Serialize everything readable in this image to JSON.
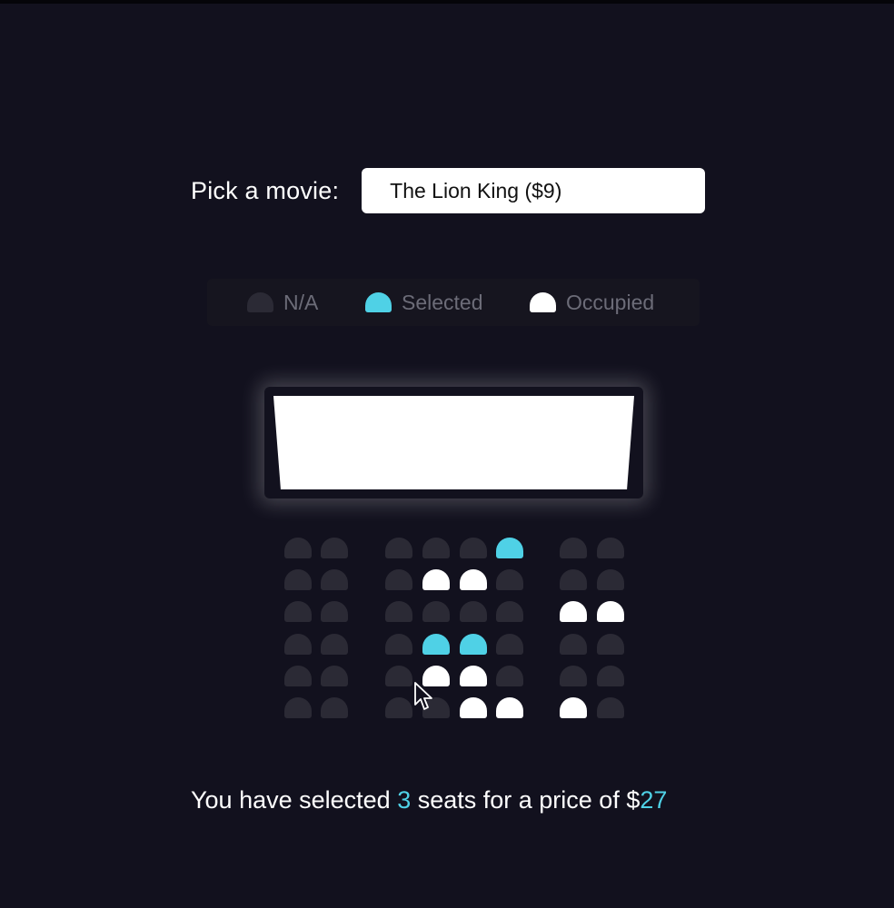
{
  "colors": {
    "background": "#12111e",
    "seat_na": "#2b2a35",
    "seat_selected": "#4fd1e6",
    "seat_occupied": "#ffffff",
    "accent": "#4fd1e6"
  },
  "movie_picker": {
    "label": "Pick a movie:",
    "selected_value": "The Lion King ($9)"
  },
  "legend": [
    {
      "status": "na",
      "label": "N/A"
    },
    {
      "status": "selected",
      "label": "Selected"
    },
    {
      "status": "occupied",
      "label": "Occupied"
    }
  ],
  "seat_rows": [
    [
      "na",
      "na",
      "na",
      "na",
      "na",
      "selected",
      "na",
      "na"
    ],
    [
      "na",
      "na",
      "na",
      "occupied",
      "occupied",
      "na",
      "na",
      "na"
    ],
    [
      "na",
      "na",
      "na",
      "na",
      "na",
      "na",
      "occupied",
      "occupied"
    ],
    [
      "na",
      "na",
      "na",
      "selected",
      "selected",
      "na",
      "na",
      "na"
    ],
    [
      "na",
      "na",
      "na",
      "occupied",
      "occupied",
      "na",
      "na",
      "na"
    ],
    [
      "na",
      "na",
      "na",
      "na",
      "occupied",
      "occupied",
      "occupied",
      "na"
    ]
  ],
  "summary": {
    "prefix": "You have selected ",
    "count": "3",
    "middle": " seats for a price of $",
    "total": "27"
  },
  "cursor_icon": "arrow-pointer-icon"
}
